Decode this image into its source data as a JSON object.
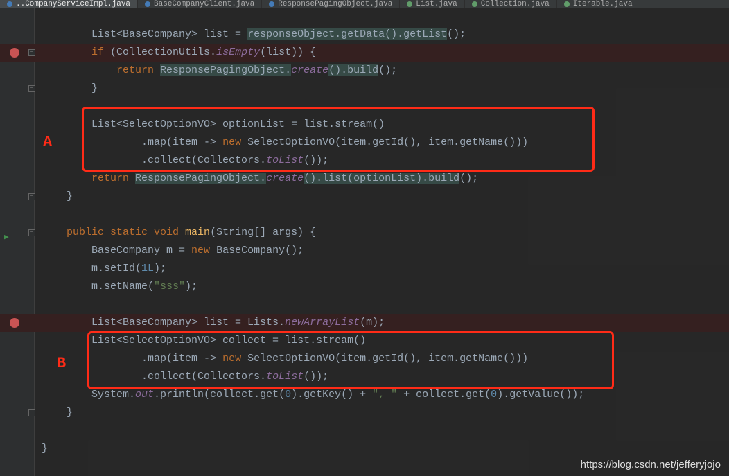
{
  "tabs": [
    {
      "label": "..CompanyServiceImpl.java",
      "color": "#4a86c7",
      "active": true
    },
    {
      "label": "BaseCompanyClient.java",
      "color": "#4a86c7",
      "active": false
    },
    {
      "label": "ResponsePagingObject.java",
      "color": "#4a86c7",
      "active": false
    },
    {
      "label": "List.java",
      "color": "#6aab73",
      "active": false
    },
    {
      "label": "Collection.java",
      "color": "#6aab73",
      "active": false
    },
    {
      "label": "Iterable.java",
      "color": "#6aab73",
      "active": false
    }
  ],
  "annotations": {
    "a": "A",
    "b": "B"
  },
  "watermark": "https://blog.csdn.net/jefferyjojo",
  "code": {
    "l1": {
      "a": "List<BaseCompany> list = ",
      "b": "responseObject.getData().getList",
      "c": "();"
    },
    "l2": {
      "a": "if ",
      "b": "(CollectionUtils.",
      "c": "isEmpty",
      "d": "(list)) {"
    },
    "l3": {
      "a": "return ",
      "b": "ResponsePagingObject.",
      "c": "create",
      "d": "().build",
      "e": "();"
    },
    "l4": "}",
    "l5": "List<SelectOptionVO> optionList = list.stream()",
    "l6": {
      "a": ".map(item -> ",
      "b": "new ",
      "c": "SelectOptionVO(item.getId(), item.getName()))"
    },
    "l7": {
      "a": ".collect(Collectors.",
      "b": "toList",
      "c": "());"
    },
    "l8": {
      "a": "return ",
      "b": "ResponsePagingObject.",
      "c": "create",
      "d": "().list(optionList).build",
      "e": "();"
    },
    "l9": "}",
    "l10": {
      "a": "public static void ",
      "b": "main",
      "c": "(String[] args) {"
    },
    "l11": {
      "a": "BaseCompany m = ",
      "b": "new ",
      "c": "BaseCompany();"
    },
    "l12": {
      "a": "m.setId(",
      "b": "1L",
      "c": ");"
    },
    "l13": {
      "a": "m.setName(",
      "b": "\"sss\"",
      "c": ");"
    },
    "l14": {
      "a": "List<BaseCompany> list = Lists.",
      "b": "newArrayList",
      "c": "(m);"
    },
    "l15": "List<SelectOptionVO> collect = list.stream()",
    "l16": {
      "a": ".map(item -> ",
      "b": "new ",
      "c": "SelectOptionVO(item.getId(), item.getName()))"
    },
    "l17": {
      "a": ".collect(Collectors.",
      "b": "toList",
      "c": "());"
    },
    "l18": {
      "a": "System.",
      "b": "out",
      "c": ".println(collect.get(",
      "d": "0",
      "e": ").getKey() + ",
      "f": "\", \"",
      "g": " + collect.get(",
      "h": "0",
      "i": ").getValue());"
    },
    "l19": "}",
    "l20": "}"
  }
}
